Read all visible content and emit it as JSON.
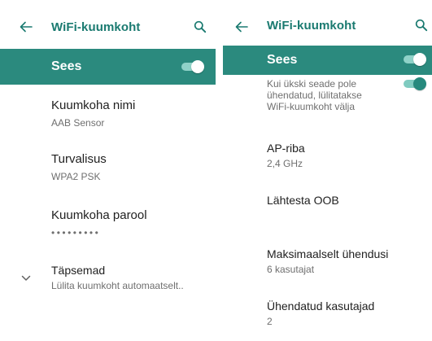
{
  "colors": {
    "accent": "#2b8a7e",
    "title_text": "#1a7a70",
    "primary_text": "#212121",
    "secondary_text": "#6f6f6f"
  },
  "left_screen": {
    "appbar": {
      "back_icon": "arrow-left-icon",
      "title": "WiFi-kuumkoht",
      "search_icon": "search-icon"
    },
    "master_switch": {
      "label": "Sees",
      "on": true
    },
    "items": [
      {
        "title": "Kuumkoha nimi",
        "value": "AAB Sensor"
      },
      {
        "title": "Turvalisus",
        "value": "WPA2 PSK"
      },
      {
        "title": "Kuumkoha parool",
        "value": "•••••••••"
      }
    ],
    "advanced": {
      "icon": "chevron-down-icon",
      "title": "Täpsemad",
      "summary": "Lülita kuumkoht automaatselt.."
    }
  },
  "right_screen": {
    "appbar": {
      "back_icon": "arrow-left-icon",
      "title": "WiFi-kuumkoht",
      "search_icon": "search-icon"
    },
    "master_switch": {
      "label": "Sees",
      "on": true
    },
    "auto_off": {
      "line1": "Kui ükski seade pole",
      "line2": "ühendatud, lülitatakse",
      "line3": "WiFi-kuumkoht välja",
      "on": true
    },
    "items": [
      {
        "title": "AP-riba",
        "value": "2,4 GHz"
      },
      {
        "title": "Lähtesta OOB",
        "value": ""
      },
      {
        "title": "Maksimaalselt ühendusi",
        "value": "6 kasutajat"
      },
      {
        "title": "Ühendatud kasutajad",
        "value": "2"
      }
    ]
  }
}
